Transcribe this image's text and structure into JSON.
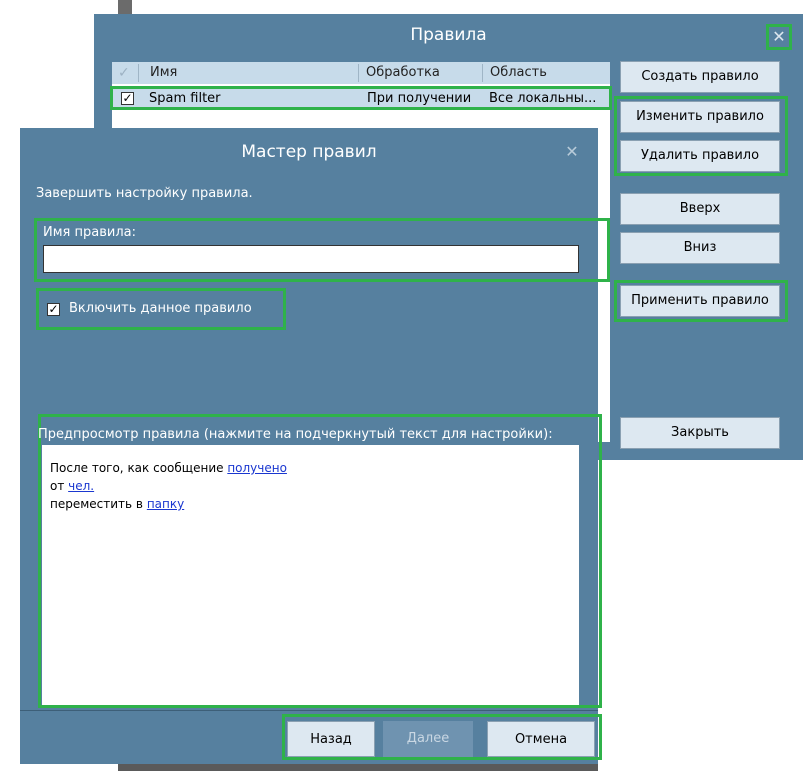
{
  "rules_dialog": {
    "title": "Правила",
    "close_glyph": "✕",
    "table": {
      "columns": [
        "Имя",
        "Обработка",
        "Область"
      ],
      "rows": [
        {
          "enabled": true,
          "name": "Spam filter",
          "processing": "При получении",
          "scope": "Все локальны..."
        }
      ]
    },
    "buttons": {
      "create": "Создать правило",
      "edit": "Изменить правило",
      "delete": "Удалить правило",
      "up": "Вверх",
      "down": "Вниз",
      "apply": "Применить правило",
      "close": "Закрыть"
    }
  },
  "wizard": {
    "title": "Мастер правил",
    "close_glyph": "✕",
    "subtitle": "Завершить настройку правила.",
    "name_label": "Имя правила:",
    "name_value": "",
    "enable_label": "Включить данное правило",
    "enable_checked": true,
    "preview_label": "Предпросмотр правила (нажмите на подчеркнутый текст для настройки):",
    "preview": {
      "line1_text": "После того, как сообщение ",
      "line1_link": "получено",
      "line2_text": "от ",
      "line2_link": "чел.",
      "line3_text": "переместить в ",
      "line3_link": "папку"
    },
    "buttons": {
      "back": "Назад",
      "next": "Далее",
      "cancel": "Отмена"
    }
  },
  "colors": {
    "dialog_bg": "#56809f",
    "highlight": "#2fb24a",
    "link": "#1a37d0",
    "header_bg": "#c7dbea"
  }
}
